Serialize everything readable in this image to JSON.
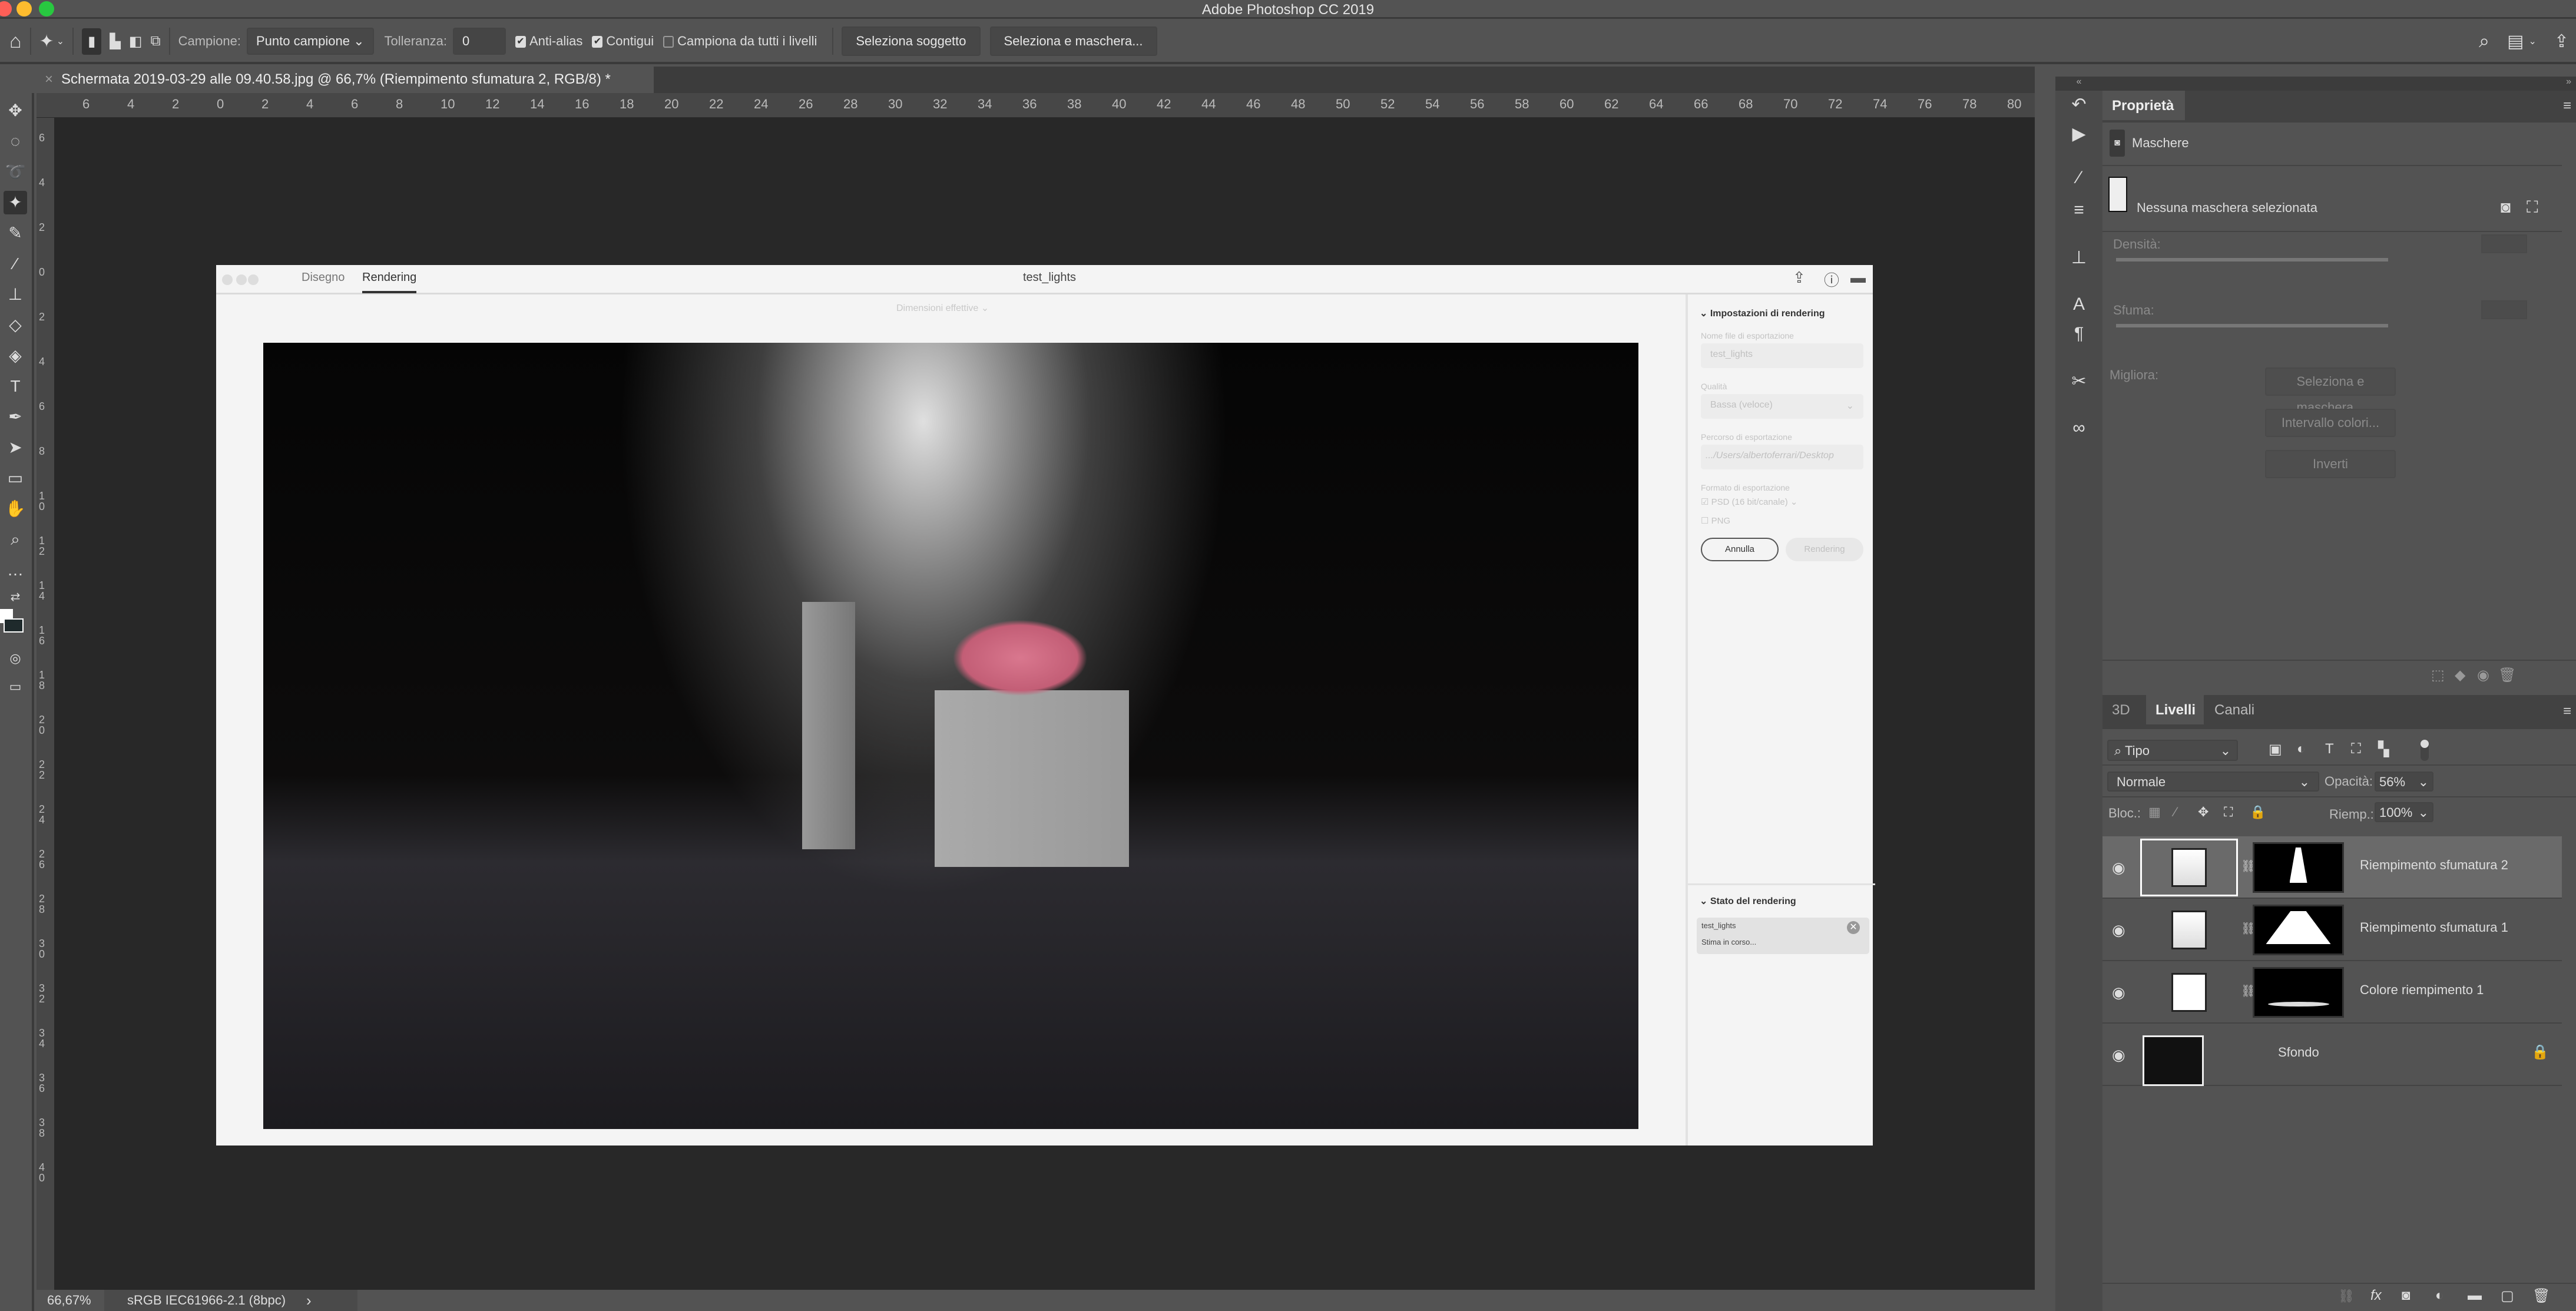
{
  "app": {
    "title": "Adobe Photoshop CC 2019"
  },
  "options": {
    "campione_label": "Campione:",
    "campione_value": "Punto campione",
    "tolleranza_label": "Tolleranza:",
    "tolleranza_value": "0",
    "antialias_label": "Anti-alias",
    "antialias_checked": true,
    "contigui_label": "Contigui",
    "contigui_checked": true,
    "campiona_tutti_label": "Campiona da tutti i livelli",
    "campiona_tutti_checked": false,
    "seleziona_soggetto": "Seleziona soggetto",
    "seleziona_maschera": "Seleziona e maschera..."
  },
  "document": {
    "tab_title": "Schermata 2019-03-29 alle 09.40.58.jpg @ 66,7% (Riempimento sfumatura 2, RGB/8) *",
    "close": "×"
  },
  "rulers": {
    "top": [
      "6",
      "4",
      "2",
      "0",
      "2",
      "4",
      "6",
      "8",
      "10",
      "12",
      "14",
      "16",
      "18",
      "20",
      "22",
      "24",
      "26",
      "28",
      "30",
      "32",
      "34",
      "36",
      "38",
      "40",
      "42",
      "44",
      "46",
      "48",
      "50",
      "52",
      "54",
      "56",
      "58",
      "60",
      "62",
      "64",
      "66",
      "68",
      "70",
      "72",
      "74",
      "76",
      "78",
      "80"
    ],
    "left": [
      "6",
      "4",
      "2",
      "0",
      "2",
      "4",
      "6",
      "8",
      "10",
      "12",
      "14",
      "16",
      "18",
      "20",
      "22",
      "24",
      "26",
      "28",
      "30",
      "32",
      "34",
      "36",
      "38",
      "40"
    ]
  },
  "status": {
    "zoom": "66,67%",
    "profile": "sRGB IEC61966-2.1 (8bpc)",
    "arrow": "›"
  },
  "dialog": {
    "tabs": [
      "Disegno",
      "Rendering"
    ],
    "active_tab": "Rendering",
    "title": "test_lights",
    "dimensions": "Dimensioni effettive ⌄",
    "settings": {
      "header": "Impostazioni di rendering",
      "filename_label": "Nome file di esportazione",
      "filename_value": "test_lights",
      "quality_label": "Qualità",
      "quality_value": "Bassa (veloce)",
      "path_label": "Percorso di esportazione",
      "path_value": ".../Users/albertoferrari/Desktop",
      "format_label": "Formato di esportazione",
      "psd_label": "PSD (16 bit/canale)",
      "psd_checked": true,
      "png_label": "PNG",
      "png_checked": false,
      "cancel": "Annulla",
      "render": "Rendering"
    },
    "status": {
      "header": "Stato del rendering",
      "job_name": "test_lights",
      "job_status": "Stima in corso..."
    }
  },
  "properties": {
    "tab": "Proprietà",
    "section": "Maschere",
    "mask_status": "Nessuna maschera selezionata",
    "density_label": "Densità:",
    "feather_label": "Sfuma:",
    "refine_label": "Migliora:",
    "buttons": [
      "Seleziona e maschera...",
      "Intervallo colori...",
      "Inverti"
    ]
  },
  "layers_panel": {
    "tabs": [
      "3D",
      "Livelli",
      "Canali"
    ],
    "active_tab": "Livelli",
    "filter": "Tipo",
    "blend_mode": "Normale",
    "opacity_label": "Opacità:",
    "opacity_value": "56%",
    "lock_label": "Bloc.:",
    "fill_label": "Riemp.:",
    "fill_value": "100%",
    "layers": [
      {
        "name": "Riempimento sfumatura 2",
        "visible": true,
        "selected": true
      },
      {
        "name": "Riempimento sfumatura 1",
        "visible": true,
        "selected": false
      },
      {
        "name": "Colore riempimento 1",
        "visible": true,
        "selected": false
      },
      {
        "name": "Sfondo",
        "visible": true,
        "selected": false,
        "locked": true
      }
    ]
  },
  "colors": {
    "ui_bg": "#535353",
    "dialog_bg": "#f4f4f4",
    "canvas_bg": "#282828"
  }
}
